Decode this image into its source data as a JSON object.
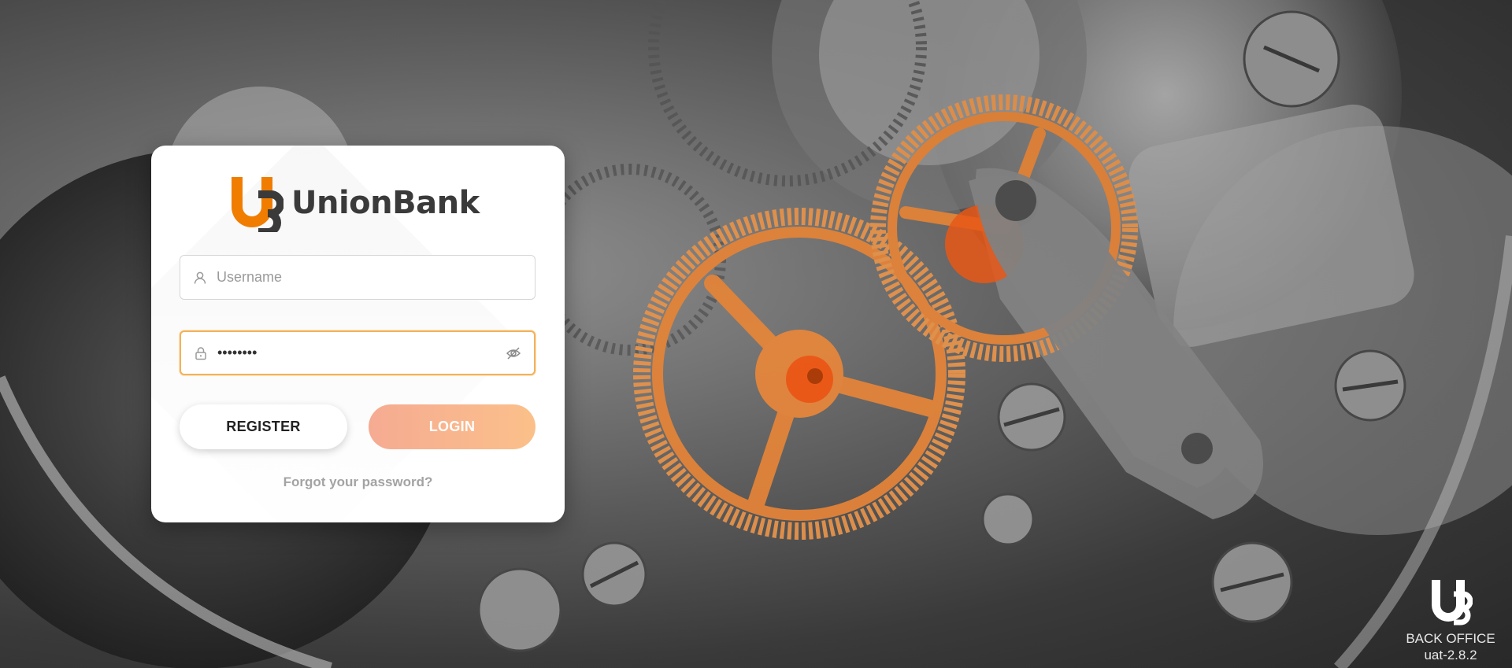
{
  "brand": {
    "name": "UnionBank",
    "accent": "#f07d00",
    "text_color": "#3a3a3a"
  },
  "login_form": {
    "username_placeholder": "Username",
    "password_value": "••••••••",
    "register_label": "REGISTER",
    "login_label": "LOGIN",
    "forgot_label": "Forgot your password?"
  },
  "icons": {
    "username": "user-icon",
    "password": "lock-icon",
    "toggle": "eye-slash-icon"
  },
  "footer": {
    "app_name": "BACK OFFICE",
    "version": "uat-2.8.2"
  }
}
